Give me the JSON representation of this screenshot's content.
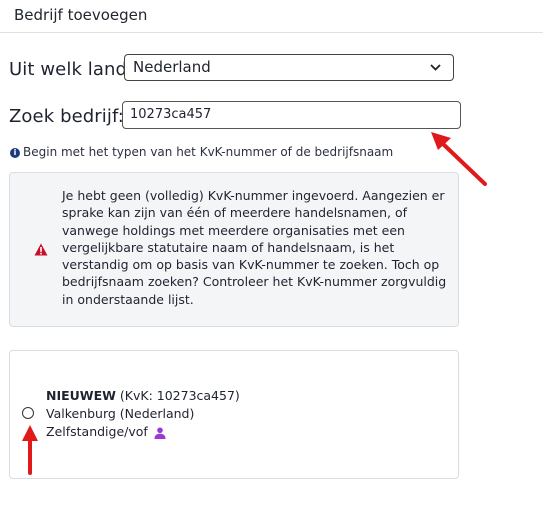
{
  "header": {
    "title": "Bedrijf toevoegen"
  },
  "country": {
    "label": "Uit welk land:",
    "selected": "Nederland"
  },
  "search": {
    "label": "Zoek bedrijf:",
    "value": "10273ca457"
  },
  "hint": {
    "text": "Begin met het typen van het KvK-nummer of de bedrijfsnaam"
  },
  "warning": {
    "text": "Je hebt geen (volledig) KvK-nummer ingevoerd. Aangezien er sprake kan zijn van één of meerdere handelsnamen, of vanwege holdings met meerdere organisaties met een vergelijkbare statutaire naam of handelsnaam, is het verstandig om op basis van KvK-nummer te zoeken. Toch op bedrijfsnaam zoeken? Controleer het KvK-nummer zorgvuldig in onderstaande lijst."
  },
  "result": {
    "name": "NIEUWEW",
    "kvk": "(KvK: 10273ca457)",
    "location": "Valkenburg (Nederland)",
    "type": "Zelfstandige/vof"
  },
  "colors": {
    "arrow": "#e0191b",
    "warning_icon": "#c8102e",
    "user_icon": "#9b37d6",
    "info_icon": "#1c3a7a"
  }
}
